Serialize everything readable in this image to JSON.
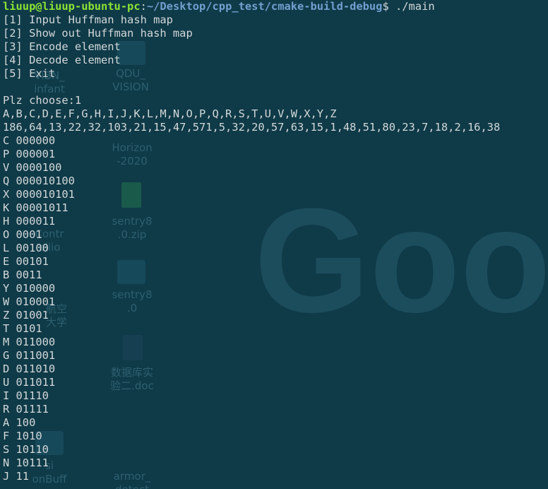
{
  "prompt": {
    "user_host": "liuup@liuup-ubuntu-pc",
    "separator": ":",
    "path": "~/Desktop/cpp_test/cmake-build-debug",
    "dollar": "$",
    "command": " ./main"
  },
  "menu": [
    "[1] Input Huffman hash map",
    "[2] Show out Huffman hash map",
    "[3] Encode element",
    "[4] Decode element",
    "[5] Exit"
  ],
  "choose_line": "Plz choose:1",
  "letters_line": "A,B,C,D,E,F,G,H,I,J,K,L,M,N,O,P,Q,R,S,T,U,V,W,X,Y,Z",
  "weights_line": "186,64,13,22,32,103,21,15,47,571,5,32,20,57,63,15,1,48,51,80,23,7,18,2,16,38",
  "codes": [
    "C 000000",
    "P 000001",
    "V 0000100",
    "Q 000010100",
    "X 000010101",
    "K 00001011",
    "H 000011",
    "O 0001",
    "L 00100",
    "E 00101",
    "B 0011",
    "Y 010000",
    "W 010001",
    "Z 01001",
    "T 0101",
    "M 011000",
    "G 011001",
    "D 011010",
    "U 011011",
    "I 01110",
    "R 01111",
    "A 100",
    "F 1010",
    "S 10110",
    "N 10111",
    "J 11"
  ],
  "desktop_background": {
    "labels": {
      "item_1": "ViBN_\ninfant",
      "item_2": "QDU_\nVISION",
      "item_3": "Horizon\n-2020",
      "item_4": "sentry8\n.0.zip",
      "item_5": "Contr\nollio",
      "item_6": "sentry8\n.0",
      "item_7": "航空\n大学",
      "item_8": "数据库实\n验二.doc",
      "item_9": "si\nonBuff",
      "item_10": "armor_\ndetect"
    },
    "watermark_text": "Goog"
  },
  "colors": {
    "background": "#0f3a48",
    "prompt_user": "#8ae234",
    "prompt_path": "#729fcf",
    "text": "#d2d8d9"
  }
}
